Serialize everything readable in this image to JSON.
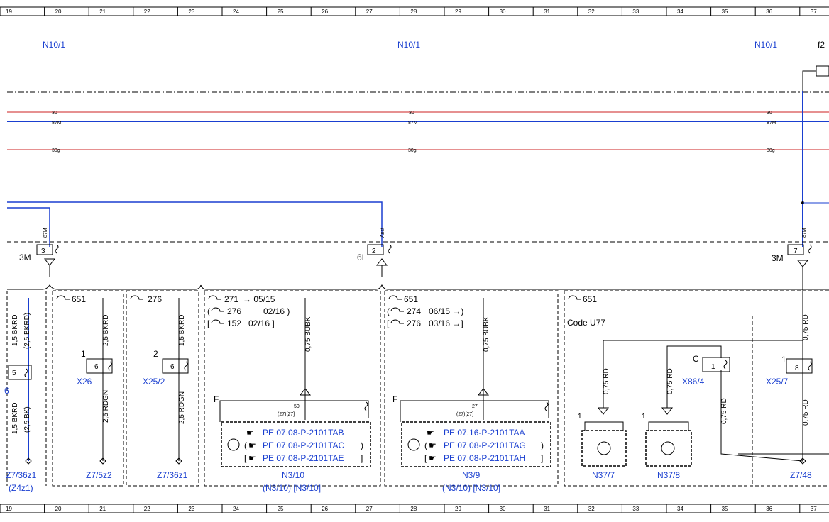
{
  "columns": [
    "19",
    "20",
    "21",
    "22",
    "23",
    "24",
    "25",
    "26",
    "27",
    "28",
    "29",
    "30",
    "31",
    "32",
    "33",
    "34",
    "35",
    "36",
    "37"
  ],
  "header_labels": [
    "N10/1",
    "N10/1",
    "N10/1",
    "f2"
  ],
  "bus_labels": {
    "line30": "30",
    "line87M": "87M",
    "line30g": "30g"
  },
  "colors": {
    "red": "#cc2222",
    "blue": "#1a3fd0",
    "black": "#000000"
  },
  "splices": [
    {
      "pin": "3",
      "ref": "3M",
      "wire": "87M"
    },
    {
      "pin": "2",
      "ref": "6I",
      "wire": "Anst"
    },
    {
      "pin": "7",
      "ref": "3M",
      "wire": "87M"
    }
  ],
  "modules": {
    "m1": {
      "wire_top": "1,5 BKRD",
      "wire_top_alt": "(2,5 BKRD)",
      "pin": "5",
      "wire_bot": "1,5 BKRD",
      "wire_bot_alt": "(2,5 BK)",
      "conn_partial": "6",
      "ground": "Z7/36z1",
      "ground_alt": "(Z4z1)"
    },
    "m2": {
      "code": "651",
      "wire_top": "2,5 BKRD",
      "pin_out": "1",
      "pin_in": "6",
      "conn": "X26",
      "wire_bot": "2,5 RDGN",
      "ground": "Z7/5z2"
    },
    "m3": {
      "code": "276",
      "wire_top": "1,5 BKRD",
      "pin_out": "2",
      "pin_in": "6",
      "conn": "X25/2",
      "wire_bot": "2,5 RDGN",
      "ground": "Z7/36z1"
    },
    "m4": {
      "codes": [
        "271",
        "276",
        "152"
      ],
      "code_text": [
        "→ 05/15",
        "02/16 )",
        "02/16 ]"
      ],
      "code_prefix": [
        "",
        "(",
        "["
      ],
      "wire": "0,75 BUBK",
      "pin_F": "F",
      "pin_a": "50",
      "pin_b": "(27)[27]",
      "refs": [
        "PE 07.08-P-2101TAB",
        "PE 07.08-P-2101TAC",
        "PE 07.08-P-2101TAE"
      ],
      "ref_open": [
        "",
        "(",
        "["
      ],
      "ref_close": [
        "",
        ")",
        "]"
      ],
      "name": "N3/10",
      "alt": "(N3/10) [N3/10]"
    },
    "m5": {
      "codes": [
        "651",
        "274",
        "276"
      ],
      "code_text": [
        "",
        "06/15 →)",
        "03/16 →]"
      ],
      "code_prefix": [
        "",
        "(",
        "["
      ],
      "wire": "0,75 BUBK",
      "pin_F": "F",
      "pin_a": "27",
      "pin_b": "(27)[27]",
      "refs": [
        "PE 07.16-P-2101TAA",
        "PE 07.08-P-2101TAG",
        "PE 07.08-P-2101TAH"
      ],
      "ref_open": [
        "",
        "(",
        "["
      ],
      "ref_close": [
        "",
        ")",
        "]"
      ],
      "name": "N3/9",
      "alt": "(N3/10) [N3/10]"
    },
    "m6": {
      "code": "651",
      "code_label": "Code U77",
      "wire1": "0,75 RD",
      "wire2": "0,75 RD",
      "wire3": "0,75 RD",
      "wire4": "0,75 RD",
      "wire5": "0,75 RD",
      "pin1": "1",
      "pin2": "1",
      "pinC": "C",
      "pinConn": "1",
      "sensor1": "N37/7",
      "sensor2": "N37/8",
      "conn": "X86/4",
      "conn2": "X25/7",
      "conn2_pin": "1",
      "conn2_in": "8",
      "ground": "Z7/48"
    }
  }
}
